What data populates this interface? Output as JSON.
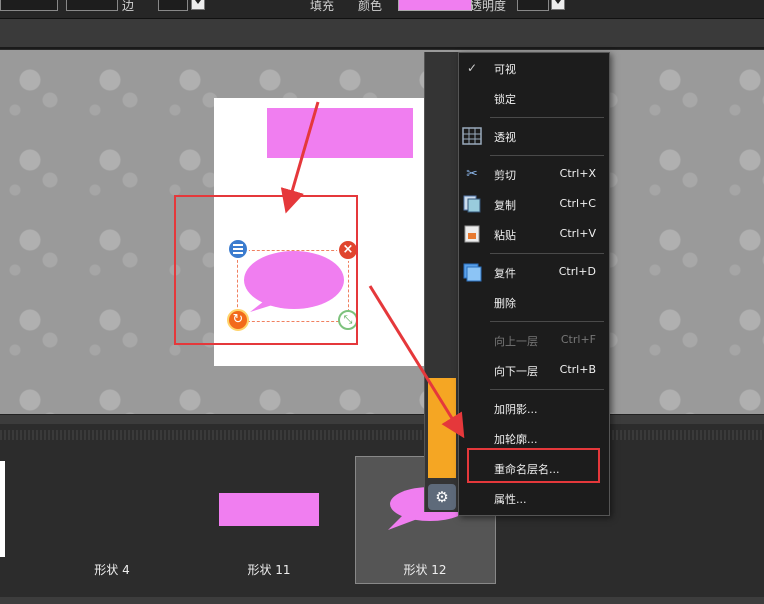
{
  "toolbar": {
    "partial_label_1": "边",
    "partial_label_2": "填充",
    "partial_label_3": "颜色",
    "partial_label_4": "透明度",
    "fill_color": "#f07ef0"
  },
  "canvas": {
    "rect_color": "#f07ef0",
    "bubble_color": "#f07ef0"
  },
  "context_menu": {
    "items": [
      {
        "label": "可视",
        "shortcut": "",
        "checked": true,
        "icon": "check-icon"
      },
      {
        "label": "锁定",
        "shortcut": "",
        "icon": ""
      },
      {
        "label": "透视",
        "shortcut": "",
        "icon": "grid-icon"
      },
      {
        "label": "剪切",
        "shortcut": "Ctrl+X",
        "icon": "scissors-icon"
      },
      {
        "label": "复制",
        "shortcut": "Ctrl+C",
        "icon": "copy-icon"
      },
      {
        "label": "粘贴",
        "shortcut": "Ctrl+V",
        "icon": "paste-icon"
      },
      {
        "label": "复件",
        "shortcut": "Ctrl+D",
        "icon": "duplicate-icon"
      },
      {
        "label": "删除",
        "shortcut": "",
        "icon": ""
      },
      {
        "label": "向上一层",
        "shortcut": "Ctrl+F",
        "disabled": true
      },
      {
        "label": "向下一层",
        "shortcut": "Ctrl+B"
      },
      {
        "label": "加阴影...",
        "shortcut": ""
      },
      {
        "label": "加轮廓...",
        "shortcut": ""
      },
      {
        "label": "重命名层名...",
        "shortcut": "",
        "highlighted": true
      },
      {
        "label": "属性...",
        "shortcut": ""
      }
    ]
  },
  "thumbnails": [
    {
      "label": "形状 4"
    },
    {
      "label": "形状 11"
    },
    {
      "label": "形状 12",
      "selected": true
    }
  ],
  "colors": {
    "annotation_red": "#e5383b",
    "menu_bg": "#1c1c1c",
    "shape_pink": "#f07ef0"
  }
}
